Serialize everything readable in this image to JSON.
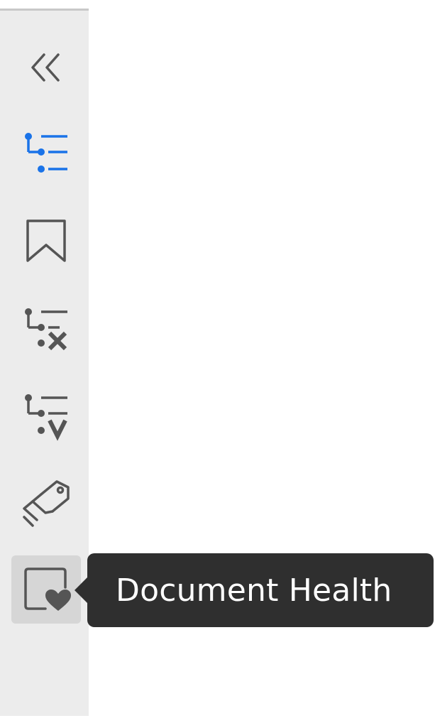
{
  "sidebar": {
    "items": [
      {
        "id": "collapse",
        "icon": "double-chevron-left-icon",
        "state": "default"
      },
      {
        "id": "outline",
        "icon": "outline-tree-icon",
        "state": "active",
        "color": "#1a73e8"
      },
      {
        "id": "bookmarks",
        "icon": "bookmark-icon",
        "state": "default"
      },
      {
        "id": "outline-remove",
        "icon": "outline-x-icon",
        "state": "default"
      },
      {
        "id": "outline-validate",
        "icon": "outline-v-icon",
        "state": "default"
      },
      {
        "id": "tags",
        "icon": "tags-icon",
        "state": "default"
      },
      {
        "id": "document-health",
        "icon": "document-health-icon",
        "state": "hover"
      }
    ]
  },
  "tooltip": {
    "text": "Document Health"
  },
  "colors": {
    "sidebar_bg": "#ececec",
    "icon_default": "#555555",
    "icon_active": "#1a73e8",
    "hover_bg": "#d6d6d6",
    "tooltip_bg": "#2f2f2f",
    "tooltip_text": "#ffffff"
  }
}
